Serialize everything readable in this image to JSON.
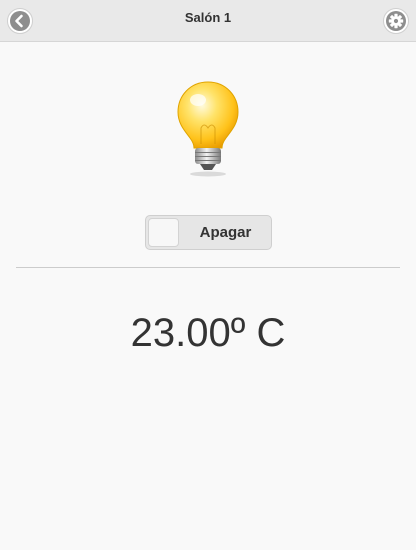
{
  "header": {
    "title": "Salón 1",
    "back_icon": "chevron-left-icon",
    "settings_icon": "gear-icon"
  },
  "device": {
    "icon": "lightbulb-icon",
    "state": "on",
    "toggle_label": "Apagar",
    "temperature": "23.00º C"
  },
  "colors": {
    "header_background": "#e9e9e9",
    "page_background": "#f9f9f9",
    "button_icon_background": "#8e8e8e",
    "bulb_glow": "#ffd21a"
  }
}
